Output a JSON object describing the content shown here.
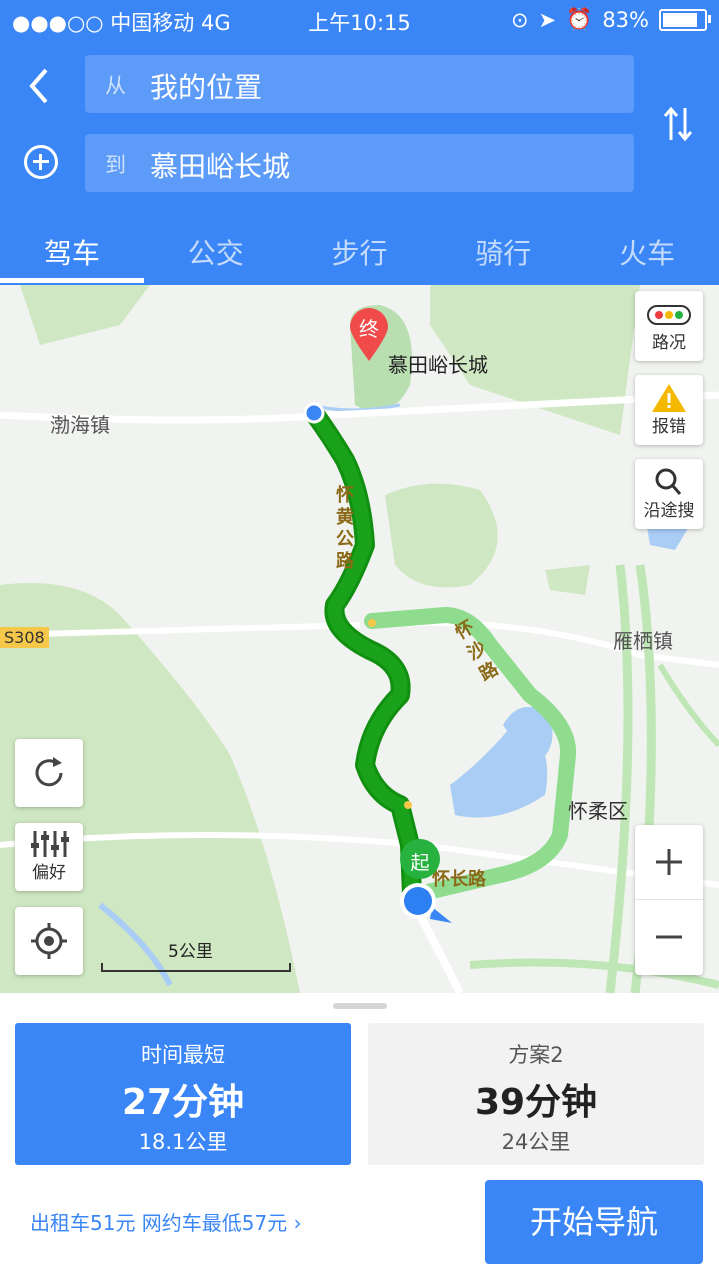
{
  "status_bar": {
    "carrier": "●●●○○ 中国移动  4G",
    "time": "上午10:15",
    "battery": "83%"
  },
  "route": {
    "from_prefix": "从",
    "from_value": "我的位置",
    "to_prefix": "到",
    "to_value": "慕田峪长城"
  },
  "tabs": [
    {
      "label": "驾车",
      "active": true
    },
    {
      "label": "公交",
      "active": false
    },
    {
      "label": "步行",
      "active": false
    },
    {
      "label": "骑行",
      "active": false
    },
    {
      "label": "火车",
      "active": false
    }
  ],
  "map": {
    "labels": {
      "destination": "慕田峪长城",
      "bohai": "渤海镇",
      "yanqi": "雁栖镇",
      "huairou": "怀柔区",
      "road_huaihuang": "怀黄公路",
      "road_huaisha": "怀沙路",
      "road_huaichang": "怀长路",
      "s308": "S308"
    },
    "markers": {
      "end": "终",
      "start": "起"
    },
    "controls": {
      "traffic": "路况",
      "report": "报错",
      "search_along": "沿途搜",
      "preference": "偏好"
    },
    "scale": "5公里"
  },
  "plans": [
    {
      "title": "时间最短",
      "duration": "27分钟",
      "distance": "18.1公里",
      "selected": true
    },
    {
      "title": "方案2",
      "duration": "39分钟",
      "distance": "24公里",
      "selected": false
    }
  ],
  "fare": {
    "text": "出租车51元  网约车最低57元"
  },
  "start_nav": "开始导航",
  "colors": {
    "accent": "#3a86f7",
    "route_main": "#1aa31a",
    "route_alt": "#8fdc8f"
  }
}
